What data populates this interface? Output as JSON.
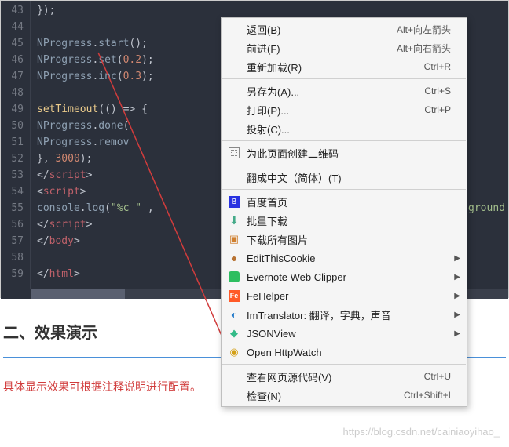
{
  "editor": {
    "lines": [
      "43",
      "44",
      "45",
      "46",
      "47",
      "48",
      "49",
      "50",
      "51",
      "52",
      "53",
      "54",
      "55",
      "56",
      "57",
      "58",
      "59"
    ],
    "code": {
      "l43": "            });",
      "l45_a": "NProgress",
      "l45_b": ".",
      "l45_c": "start",
      "l45_d": "();",
      "l46_a": "NProgress",
      "l46_b": ".",
      "l46_c": "set",
      "l46_d": "(",
      "l46_e": "0.2",
      "l46_f": ");",
      "l47_a": "NProgress",
      "l47_b": ".",
      "l47_c": "inc",
      "l47_d": "(",
      "l47_e": "0.3",
      "l47_f": ");",
      "l49_a": "setTimeout",
      "l49_b": "(() ",
      "l49_c": "=>",
      "l49_d": " {",
      "l50_a": "NProgress",
      "l50_b": ".",
      "l50_c": "done",
      "l50_d": "(",
      "l51_a": "NProgress",
      "l51_b": ".",
      "l51_c": "remov",
      "l52_a": "}, ",
      "l52_b": "3000",
      "l52_c": ");",
      "l53_a": "</",
      "l53_b": "script",
      "l53_c": ">",
      "l54_a": "<",
      "l54_b": "script",
      "l54_c": ">",
      "l55_a": "console",
      "l55_b": ".",
      "l55_c": "log",
      "l55_d": "(",
      "l55_e": "\"%c \"",
      "l55_f": " ,",
      "l55_g": "ground",
      "l56_a": "</",
      "l56_b": "script",
      "l56_c": ">",
      "l57_a": "</",
      "l57_b": "body",
      "l57_c": ">",
      "l59_a": "</",
      "l59_b": "html",
      "l59_c": ">"
    }
  },
  "menu": {
    "back": "返回(B)",
    "back_sc": "Alt+向左箭头",
    "forward": "前进(F)",
    "forward_sc": "Alt+向右箭头",
    "reload": "重新加载(R)",
    "reload_sc": "Ctrl+R",
    "saveas": "另存为(A)...",
    "saveas_sc": "Ctrl+S",
    "print": "打印(P)...",
    "print_sc": "Ctrl+P",
    "cast": "投射(C)...",
    "qr": "为此页面创建二维码",
    "translate": "翻成中文（简体）(T)",
    "baidu": "百度首页",
    "batchdl": "批量下载",
    "dlimg": "下载所有图片",
    "editcookie": "EditThisCookie",
    "evernote": "Evernote Web Clipper",
    "fehelper": "FeHelper",
    "imtrans": "ImTranslator: 翻译，字典，声音",
    "jsonview": "JSONView",
    "httpwatch": "Open HttpWatch",
    "viewsrc": "查看网页源代码(V)",
    "viewsrc_sc": "Ctrl+U",
    "inspect": "检查(N)",
    "inspect_sc": "Ctrl+Shift+I"
  },
  "section": {
    "title": "二、效果演示",
    "note": "具体显示效果可根据注释说明进行配置。"
  },
  "watermark": "https://blog.csdn.net/cainiaoyihao_"
}
